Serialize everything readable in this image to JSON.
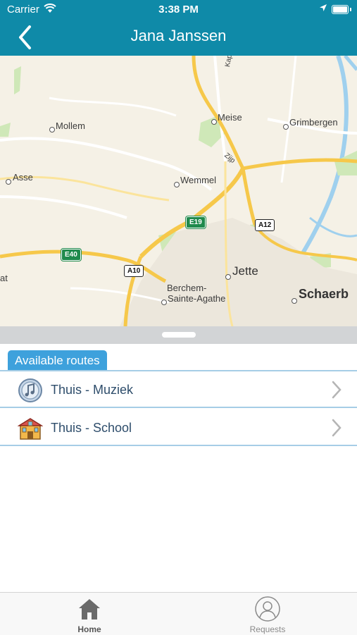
{
  "status_bar": {
    "carrier": "Carrier",
    "time": "3:38 PM"
  },
  "nav": {
    "title": "Jana Janssen"
  },
  "map": {
    "labels": {
      "mollem": "Mollem",
      "meise": "Meise",
      "grimbergen": "Grimbergen",
      "asse": "Asse",
      "wemmel": "Wemmel",
      "kapellelaan": "Kapellelaa",
      "zijp": "Zijp",
      "jette": "Jette",
      "berchem1": "Berchem-",
      "berchem2": "Sainte-Agathe",
      "schaerbeek": "Schaerb",
      "at": "at"
    },
    "shields": {
      "e19": "E19",
      "a12": "A12",
      "e40": "E40",
      "a10": "A10"
    }
  },
  "routes": {
    "section_title": "Available routes",
    "items": [
      {
        "label": "Thuis - Muziek",
        "icon": "music-note-icon"
      },
      {
        "label": "Thuis - School",
        "icon": "school-building-icon"
      }
    ]
  },
  "tabbar": {
    "home_label": "Home",
    "requests_label": "Requests"
  },
  "colors": {
    "nav_bar": "#0f8aa8",
    "section_tab": "#3ea1dc",
    "route_text": "#2e4d6b",
    "row_divider": "#a6cde6"
  }
}
